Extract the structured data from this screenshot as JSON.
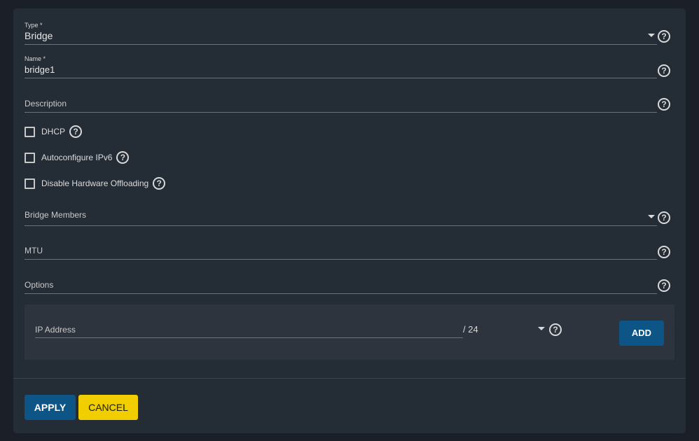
{
  "form": {
    "type": {
      "label": "Type *",
      "value": "Bridge"
    },
    "name": {
      "label": "Name *",
      "value": "bridge1"
    },
    "description": {
      "placeholder": "Description"
    },
    "checkboxes": [
      {
        "label": "DHCP",
        "checked": false
      },
      {
        "label": "Autoconfigure IPv6",
        "checked": false
      },
      {
        "label": "Disable Hardware Offloading",
        "checked": false
      }
    ],
    "bridge_members": {
      "placeholder": "Bridge Members"
    },
    "mtu": {
      "placeholder": "MTU"
    },
    "options": {
      "placeholder": "Options"
    },
    "ip_address": {
      "placeholder": "IP Address",
      "netmask": "/ 24",
      "add_label": "ADD"
    }
  },
  "actions": {
    "apply_label": "APPLY",
    "cancel_label": "CANCEL"
  },
  "icons": {
    "help": "?"
  },
  "colors": {
    "primary": "#0d5587",
    "accent": "#f0ce00",
    "card_bg": "#242c35",
    "page_bg": "#1b2028"
  }
}
